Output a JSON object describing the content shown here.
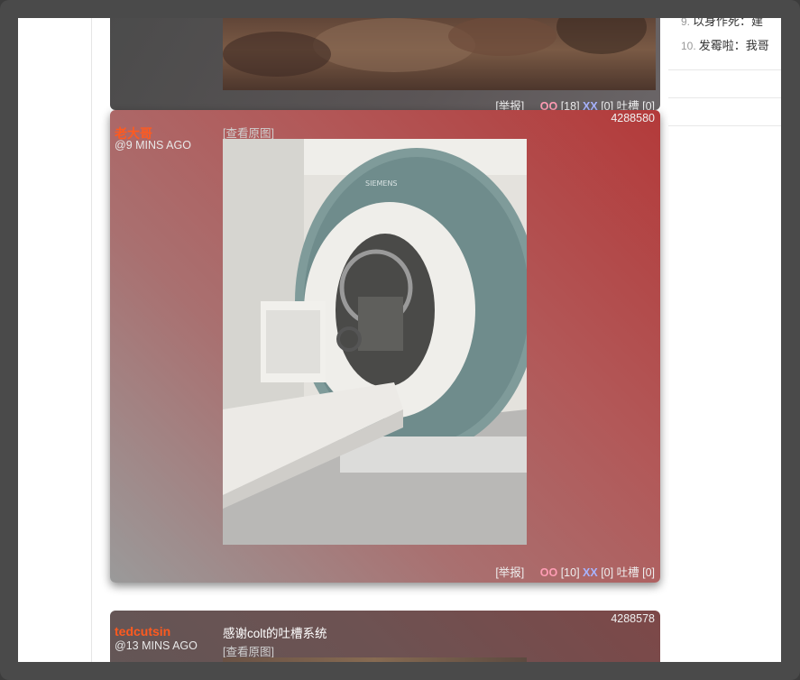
{
  "sidebar": {
    "items": [
      {
        "num": "9.",
        "text": "以身作死：建"
      },
      {
        "num": "10.",
        "text": "发霉啦：我哥"
      }
    ]
  },
  "posts": [
    {
      "footer": {
        "report": "[举报]",
        "oo_label": "OO",
        "oo_count": "[18]",
        "xx_label": "XX",
        "xx_count": "[0]",
        "tucao_label": "吐槽",
        "tucao_count": "[0]"
      }
    },
    {
      "author": "老大哥",
      "time": "@9 MINS AGO",
      "id": "4288580",
      "view_original": "[查看原图]",
      "image_brand": "SIEMENS",
      "footer": {
        "report": "[举报]",
        "oo_label": "OO",
        "oo_count": "[10]",
        "xx_label": "XX",
        "xx_count": "[0]",
        "tucao_label": "吐槽",
        "tucao_count": "[0]"
      }
    },
    {
      "author": "tedcutsin",
      "time": "@13 MINS AGO",
      "id": "4288578",
      "text": "感谢colt的吐槽系统",
      "view_original": "[查看原图]"
    }
  ]
}
